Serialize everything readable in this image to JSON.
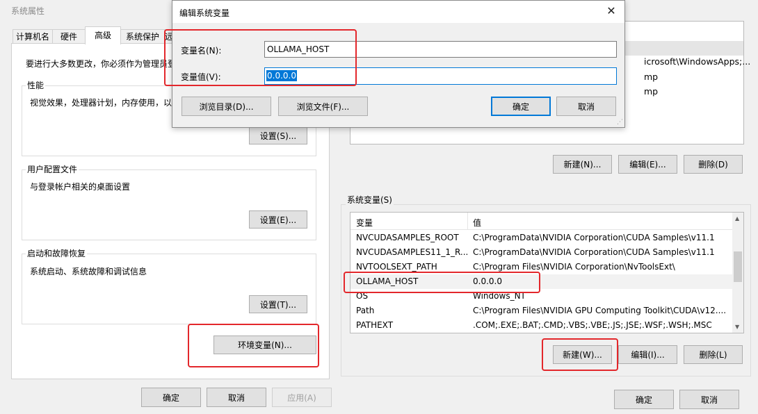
{
  "sysprops": {
    "title": "系统属性",
    "tabs": [
      "计算机名",
      "硬件",
      "高级",
      "系统保护",
      "远"
    ],
    "intro": "要进行大多数更改，你必须作为管理员登",
    "performance": {
      "title": "性能",
      "desc": "视觉效果，处理器计划，内存使用，以",
      "button": "设置(S)..."
    },
    "profiles": {
      "title": "用户配置文件",
      "desc": "与登录帐户相关的桌面设置",
      "button": "设置(E)..."
    },
    "startup": {
      "title": "启动和故障恢复",
      "desc": "系统启动、系统故障和调试信息",
      "button": "设置(T)..."
    },
    "env_button": "环境变量(N)...",
    "ok": "确定",
    "cancel": "取消",
    "apply": "应用(A)"
  },
  "envvars": {
    "user_rows": [
      {
        "value": "icrosoft\\WindowsApps;..."
      },
      {
        "value": "mp"
      },
      {
        "value": "mp"
      }
    ],
    "user_new": "新建(N)...",
    "user_edit": "编辑(E)...",
    "user_delete": "删除(D)",
    "system_title": "系统变量(S)",
    "col_var": "变量",
    "col_val": "值",
    "system_rows": [
      {
        "name": "NVCUDASAMPLES_ROOT",
        "value": "C:\\ProgramData\\NVIDIA Corporation\\CUDA Samples\\v11.1"
      },
      {
        "name": "NVCUDASAMPLES11_1_R...",
        "value": "C:\\ProgramData\\NVIDIA Corporation\\CUDA Samples\\v11.1"
      },
      {
        "name": "NVTOOLSEXT_PATH",
        "value": "C:\\Program Files\\NVIDIA Corporation\\NvToolsExt\\"
      },
      {
        "name": "OLLAMA_HOST",
        "value": "0.0.0.0"
      },
      {
        "name": "OS",
        "value": "Windows_NT"
      },
      {
        "name": "Path",
        "value": "C:\\Program Files\\NVIDIA GPU Computing Toolkit\\CUDA\\v12...."
      },
      {
        "name": "PATHEXT",
        "value": ".COM;.EXE;.BAT;.CMD;.VBS;.VBE;.JS;.JSE;.WSF;.WSH;.MSC"
      }
    ],
    "sys_new": "新建(W)...",
    "sys_edit": "编辑(I)...",
    "sys_delete": "删除(L)",
    "ok": "确定",
    "cancel": "取消"
  },
  "editdlg": {
    "title": "编辑系统变量",
    "name_label": "变量名(N):",
    "value_label": "变量值(V):",
    "name_value": "OLLAMA_HOST",
    "value_value": "0.0.0.0",
    "browse_dir": "浏览目录(D)...",
    "browse_file": "浏览文件(F)...",
    "ok": "确定",
    "cancel": "取消"
  },
  "colors": {
    "accent": "#0078d7",
    "highlight": "#e3272b",
    "selection": "#0078d7"
  }
}
